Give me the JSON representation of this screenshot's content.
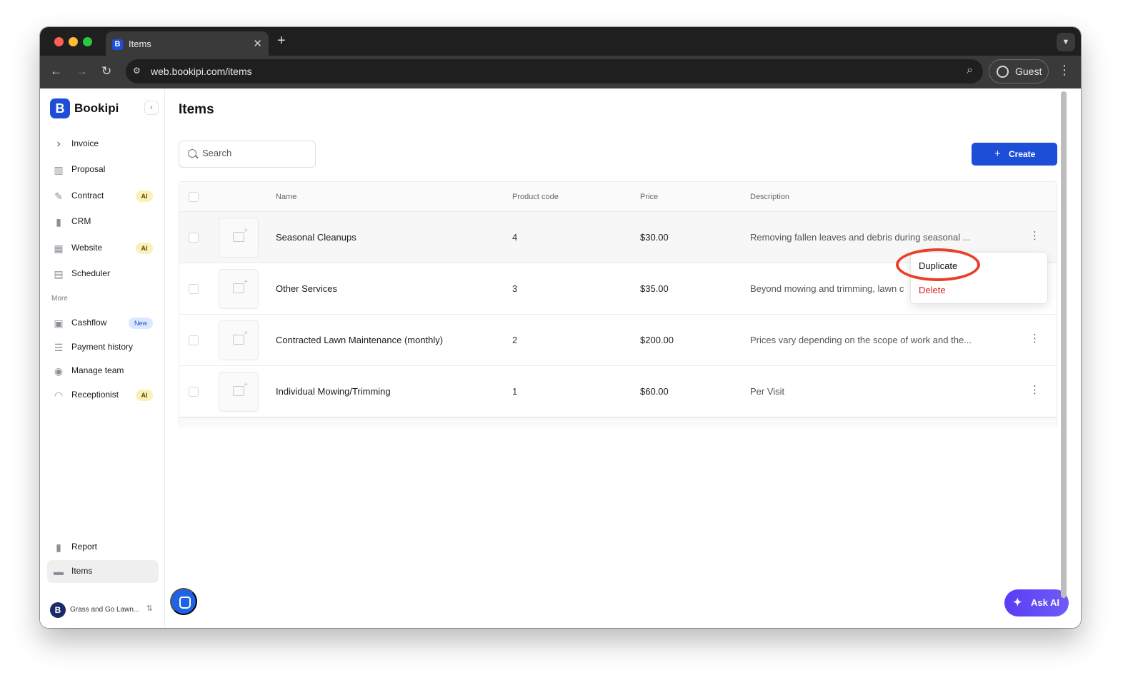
{
  "browser": {
    "tab_title": "Items",
    "tab_favicon": "B",
    "close_glyph": "✕",
    "newtab_glyph": "+",
    "url": "web.bookipi.com/items",
    "profile_label": "Guest"
  },
  "sidebar": {
    "brand_name": "Bookipi",
    "brand_logo": "B",
    "primary_items": [
      {
        "label": "Invoice",
        "icon": "chevron-right-icon",
        "glyph": "›"
      },
      {
        "label": "Proposal",
        "icon": "proposal-icon",
        "glyph": "▥"
      },
      {
        "label": "Contract",
        "icon": "contract-icon",
        "glyph": "✎",
        "badge": "AI"
      },
      {
        "label": "CRM",
        "icon": "crm-icon",
        "glyph": "▮"
      },
      {
        "label": "Website",
        "icon": "website-icon",
        "glyph": "▦",
        "badge": "AI"
      },
      {
        "label": "Scheduler",
        "icon": "calendar-icon",
        "glyph": "▤"
      }
    ],
    "section_more": "More",
    "more_items": [
      {
        "label": "Cashflow",
        "icon": "cashflow-icon",
        "glyph": "▣",
        "badge": "New"
      },
      {
        "label": "Payment history",
        "icon": "payment-history-icon",
        "glyph": "☰"
      },
      {
        "label": "Manage team",
        "icon": "team-icon",
        "glyph": "◉"
      },
      {
        "label": "Receptionist",
        "icon": "headset-icon",
        "glyph": "◠",
        "badge": "AI"
      }
    ],
    "bottom_items": [
      {
        "label": "Report",
        "icon": "report-icon",
        "glyph": "▮"
      },
      {
        "label": "Items",
        "icon": "items-icon",
        "glyph": "▬"
      }
    ],
    "account_name": "Grass and Go Lawn...",
    "account_avatar": "B"
  },
  "main": {
    "title": "Items",
    "search_placeholder": "Search",
    "create_label": "Create",
    "columns": {
      "name": "Name",
      "code": "Product code",
      "price": "Price",
      "description": "Description"
    },
    "rows": [
      {
        "name": "Seasonal Cleanups",
        "code": "4",
        "price": "$30.00",
        "description": "Removing fallen leaves and debris during seasonal ..."
      },
      {
        "name": "Other Services",
        "code": "3",
        "price": "$35.00",
        "description": "Beyond mowing and trimming, lawn c"
      },
      {
        "name": "Contracted Lawn Maintenance (monthly)",
        "code": "2",
        "price": "$200.00",
        "description": "Prices vary depending on the scope of work and the..."
      },
      {
        "name": "Individual Mowing/Trimming",
        "code": "1",
        "price": "$60.00",
        "description": "Per Visit"
      }
    ],
    "context_menu": {
      "duplicate": "Duplicate",
      "delete": "Delete"
    },
    "ask_ai_label": "Ask AI"
  },
  "colors": {
    "brand": "#1d4ed8",
    "delete": "#d11f1f",
    "highlight": "#e8402a",
    "ask_ai": "#5b3df5"
  }
}
